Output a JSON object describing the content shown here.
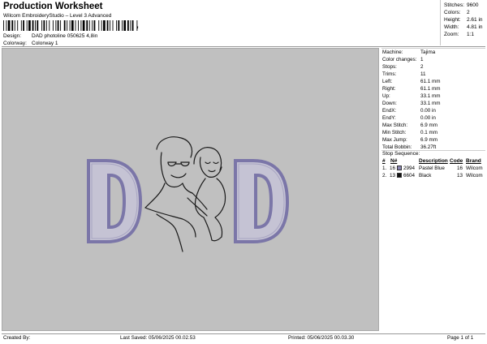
{
  "header": {
    "title": "Production Worksheet",
    "subtitle": "Wilcom EmbroideryStudio – Level 3 Advanced",
    "barcode_tail": ","
  },
  "fields": {
    "design_label": "Design:",
    "design_value": "DAD photoline 050625 4,8in",
    "colorway_label": "Colorway:",
    "colorway_value": "Colorway 1"
  },
  "stats": [
    {
      "label": "Stitches:",
      "value": "9600"
    },
    {
      "label": "Colors:",
      "value": "2"
    },
    {
      "label": "Height:",
      "value": "2.61 in"
    },
    {
      "label": "Width:",
      "value": "4.81 in"
    },
    {
      "label": "Zoom:",
      "value": "1:1"
    }
  ],
  "machine_info": [
    {
      "label": "Machine:",
      "value": "Tajima"
    },
    {
      "label": "Color changes:",
      "value": "1"
    },
    {
      "label": "Stops:",
      "value": "2"
    },
    {
      "label": "Trims:",
      "value": "11"
    },
    {
      "label": "Left:",
      "value": "61.1 mm"
    },
    {
      "label": "Right:",
      "value": "61.1 mm"
    },
    {
      "label": "Up:",
      "value": "33.1 mm"
    },
    {
      "label": "Down:",
      "value": "33.1 mm"
    },
    {
      "label": "EndX:",
      "value": "0.00 in"
    },
    {
      "label": "EndY:",
      "value": "0.00 in"
    },
    {
      "label": "Max Stitch:",
      "value": "6.9 mm"
    },
    {
      "label": "Min Stitch:",
      "value": "0.1 mm"
    },
    {
      "label": "Max Jump:",
      "value": "6.9 mm"
    },
    {
      "label": "Total Bobbin:",
      "value": "36.27ft"
    }
  ],
  "stop_sequence": {
    "title": "Stop Sequence:",
    "headers": [
      "#",
      "N#",
      "Description",
      "Code",
      "Brand"
    ],
    "rows": [
      {
        "num": "1.",
        "stitches": "16",
        "swatch_color": "#8a86b3",
        "code_n": "2994",
        "description": "Pastel Blue",
        "code": "16",
        "brand": "Wilcom"
      },
      {
        "num": "2.",
        "stitches": "13",
        "swatch_color": "#111111",
        "code_n": "6604",
        "description": "Black",
        "code": "13",
        "brand": "Wilcom"
      }
    ]
  },
  "footer": {
    "created_by": "Created By:",
    "last_saved": "Last Saved: 05/06/2025 00.02.53",
    "printed": "Printed: 05/06/2025 00.03.30",
    "page": "Page 1 of 1"
  },
  "colors": {
    "canvas_bg": "#c0c0c0",
    "letter_outline": "#7b76a8",
    "letter_fill": "#c5c3d4",
    "line_art": "#1a1a1a"
  }
}
